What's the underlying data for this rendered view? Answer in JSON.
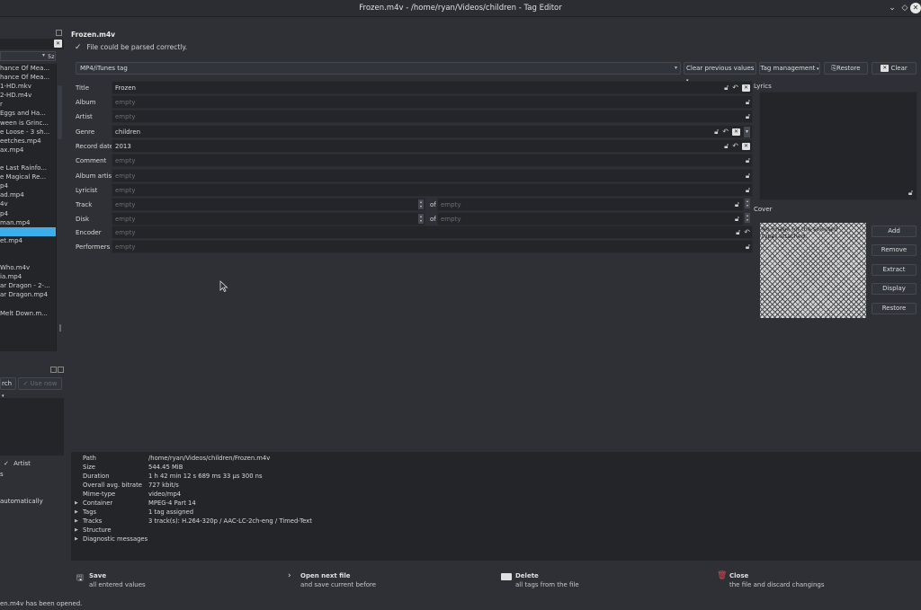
{
  "window": {
    "title": "Frozen.m4v - /home/ryan/Videos/children - Tag Editor",
    "btn_minimize": "⌄",
    "btn_maximize": "◇",
    "btn_close": "✕"
  },
  "left_panel": {
    "combo_suffix": "5z",
    "files": [
      "hance Of Mea...",
      "hance Of Mea...",
      "1-HD.mkv",
      "2-HD.m4v",
      "r",
      "Eggs and Ha...",
      "ween is Grinc...",
      "e Loose - 3 sh...",
      "eetches.mp4",
      "ax.mp4",
      "",
      "e Last Rainfo...",
      "e Magical Re...",
      "p4",
      "ad.mp4",
      "4v",
      "p4",
      "man.mp4",
      "",
      "et.mp4",
      "",
      "",
      "Who.m4v",
      "ia.mp4",
      "ar Dragon - 2-...",
      "ar Dragon.mp4",
      "",
      "Melt Down.m..."
    ],
    "selected_index": 18,
    "search_combo": "rch",
    "use_now": "Use now",
    "artist_label": "Artist",
    "s_label": "s",
    "automatically": "automatically"
  },
  "main": {
    "filename": "Frozen.m4v",
    "parse_status": "File could be parsed correctly.",
    "tag_type": "MP4/iTunes tag",
    "clear_previous": "Clear previous values",
    "tag_management": "Tag management",
    "restore": "Restore",
    "clear": "Clear",
    "empty": "empty",
    "of": "of",
    "fields": {
      "title": {
        "label": "Title",
        "value": "Frozen"
      },
      "album": {
        "label": "Album",
        "value": ""
      },
      "artist": {
        "label": "Artist",
        "value": ""
      },
      "genre": {
        "label": "Genre",
        "value": "children"
      },
      "record_date": {
        "label": "Record date",
        "value": "2013"
      },
      "comment": {
        "label": "Comment",
        "value": ""
      },
      "album_artist": {
        "label": "Album artist",
        "value": ""
      },
      "lyricist": {
        "label": "Lyricist",
        "value": ""
      },
      "track": {
        "label": "Track",
        "value": ""
      },
      "disk": {
        "label": "Disk",
        "value": ""
      },
      "encoder": {
        "label": "Encoder",
        "value": ""
      },
      "performers": {
        "label": "Performers",
        "value": ""
      }
    },
    "lyrics_label": "Lyrics",
    "cover_label": "Cover",
    "cover_text": "No image (of the selected type) attached.",
    "cover_buttons": {
      "add": "Add",
      "remove": "Remove",
      "extract": "Extract",
      "display": "Display",
      "restore": "Restore"
    }
  },
  "info": {
    "path_k": "Path",
    "path_v": "/home/ryan/Videos/children/Frozen.m4v",
    "size_k": "Size",
    "size_v": "544.45 MiB",
    "duration_k": "Duration",
    "duration_v": "1 h 42 min 12 s 689 ms 33 µs 300 ns",
    "bitrate_k": "Overall avg. bitrate",
    "bitrate_v": "727 kbit/s",
    "mime_k": "Mime-type",
    "mime_v": "video/mp4",
    "container_k": "Container",
    "container_v": "MPEG-4 Part 14",
    "tags_k": "Tags",
    "tags_v": "1 tag assigned",
    "tracks_k": "Tracks",
    "tracks_v": "3 track(s): H.264-320p / AAC-LC-2ch-eng / Timed-Text",
    "structure_k": "Structure",
    "diagnostic_k": "Diagnostic messages"
  },
  "actions": {
    "save_t": "Save",
    "save_s": "all entered values",
    "next_t": "Open next file",
    "next_s": "and save current before",
    "delete_t": "Delete",
    "delete_s": "all tags from the file",
    "close_t": "Close",
    "close_s": "the file and discard changings"
  },
  "status": "en.m4v has been opened."
}
